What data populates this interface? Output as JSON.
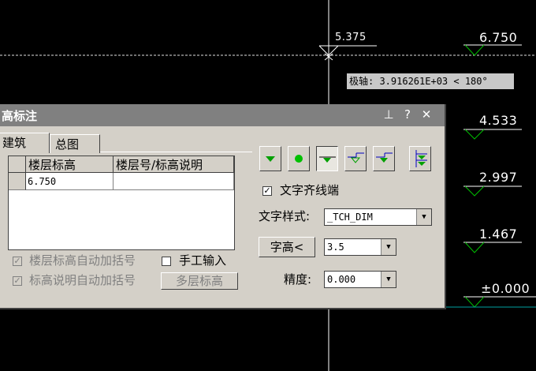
{
  "cad": {
    "top_label": "5.375",
    "elevations": [
      "6.750",
      "4.533",
      "2.997",
      "1.467",
      "±0.000"
    ],
    "polar_tooltip": "极轴: 3.916261E+03 < 180°"
  },
  "dialog": {
    "title": "高标注",
    "title_buttons": {
      "pin": "⊥",
      "help": "?",
      "close": "✕"
    },
    "tabs": [
      "建筑",
      "总图"
    ],
    "table": {
      "columns": [
        "楼层标高",
        "楼层号/标高说明"
      ],
      "rows": [
        [
          "6.750",
          ""
        ]
      ]
    },
    "checkboxes": {
      "auto_bracket_floor": {
        "label": "楼层标高自动加括号",
        "checked": true,
        "enabled": false
      },
      "auto_bracket_desc": {
        "label": "标高说明自动加括号",
        "checked": true,
        "enabled": false
      },
      "manual_input": {
        "label": "手工输入",
        "checked": false
      }
    },
    "multi_floor_button": "多层标高",
    "align_text": {
      "label": "文字齐线端",
      "checked": true
    },
    "text_style": {
      "label": "文字样式:",
      "value": "_TCH_DIM"
    },
    "text_height": {
      "button": "字高<",
      "value": "3.5"
    },
    "precision": {
      "label": "精度:",
      "value": "0.000"
    },
    "symbol_icons": [
      "elevation-triangle-filled-icon",
      "elevation-circle-icon",
      "elevation-leader-left-icon",
      "elevation-leader-blue-icon",
      "elevation-leader-filled-icon",
      "elevation-multi-flag-icon"
    ],
    "colors": {
      "green_symbol": "#00a000",
      "blue_symbol": "#0000c0"
    }
  }
}
